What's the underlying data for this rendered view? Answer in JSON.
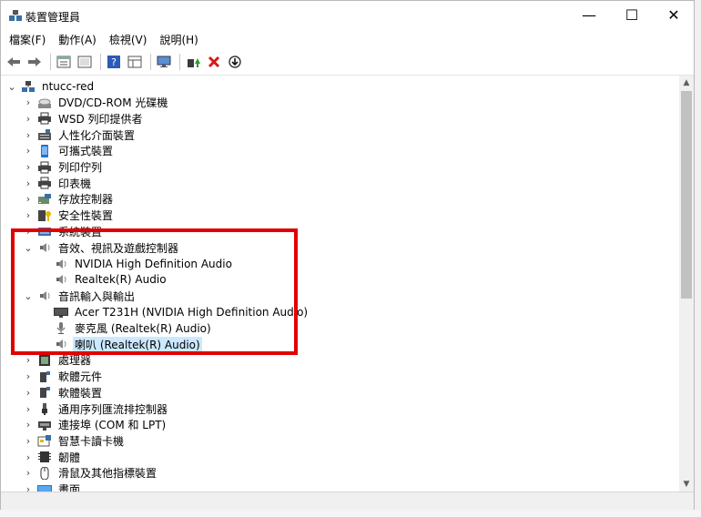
{
  "window": {
    "title": "裝置管理員",
    "controls": {
      "minimize": "—",
      "maximize": "☐",
      "close": "✕"
    }
  },
  "menu": [
    "檔案(F)",
    "動作(A)",
    "檢視(V)",
    "說明(H)"
  ],
  "toolbar": [
    "back-icon",
    "forward-icon",
    "properties-icon",
    "show-hide-icon",
    "help-icon",
    "view-icon",
    "monitor-icon",
    "update-driver-icon",
    "uninstall-icon",
    "scan-icon"
  ],
  "tree": [
    {
      "label": "ntucc-red",
      "icon": "computer",
      "expanded": true,
      "level": 0
    },
    {
      "label": "DVD/CD-ROM 光碟機",
      "icon": "dvd",
      "level": 1
    },
    {
      "label": "WSD 列印提供者",
      "icon": "printer",
      "level": 1
    },
    {
      "label": "人性化介面裝置",
      "icon": "hid",
      "level": 1
    },
    {
      "label": "可攜式裝置",
      "icon": "portable",
      "level": 1
    },
    {
      "label": "列印佇列",
      "icon": "printer",
      "level": 1
    },
    {
      "label": "印表機",
      "icon": "printer",
      "level": 1
    },
    {
      "label": "存放控制器",
      "icon": "storage",
      "level": 1
    },
    {
      "label": "安全性裝置",
      "icon": "security",
      "level": 1
    },
    {
      "label": "系統裝置",
      "icon": "system",
      "level": 1
    },
    {
      "label": "音效、視訊及遊戲控制器",
      "icon": "speaker",
      "expanded": true,
      "level": 1
    },
    {
      "label": "NVIDIA High Definition Audio",
      "icon": "speaker",
      "level": 2
    },
    {
      "label": "Realtek(R) Audio",
      "icon": "speaker",
      "level": 2
    },
    {
      "label": "音訊輸入與輸出",
      "icon": "speaker",
      "expanded": true,
      "level": 1
    },
    {
      "label": "Acer T231H (NVIDIA High Definition Audio)",
      "icon": "monitor",
      "level": 2
    },
    {
      "label": "麥克風 (Realtek(R) Audio)",
      "icon": "mic",
      "level": 2
    },
    {
      "label": "喇叭 (Realtek(R) Audio)",
      "icon": "speaker",
      "level": 2,
      "selected": true
    },
    {
      "label": "處理器",
      "icon": "cpu",
      "level": 1
    },
    {
      "label": "軟體元件",
      "icon": "software",
      "level": 1
    },
    {
      "label": "軟體裝置",
      "icon": "software",
      "level": 1
    },
    {
      "label": "通用序列匯流排控制器",
      "icon": "usb",
      "level": 1
    },
    {
      "label": "連接埠 (COM 和 LPT)",
      "icon": "port",
      "level": 1
    },
    {
      "label": "智慧卡讀卡機",
      "icon": "smartcard",
      "level": 1
    },
    {
      "label": "韌體",
      "icon": "firmware",
      "level": 1
    },
    {
      "label": "滑鼠及其他指標裝置",
      "icon": "mouse",
      "level": 1
    },
    {
      "label": "畫面",
      "icon": "display",
      "level": 1
    }
  ],
  "colors": {
    "highlight": "#e00000",
    "selection": "#cce8ff"
  }
}
